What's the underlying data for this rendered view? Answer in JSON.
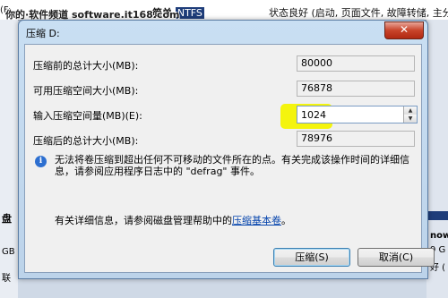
{
  "background": {
    "left_label": "(F:",
    "header_text": "简单",
    "header_fs": "NTFS",
    "status_text": "状态良好 (启动, 页面文件, 故障转储, 主分区)",
    "watermark": "你的·软件频道 software.it168.com",
    "left_disk": "盘",
    "left_b": "GB",
    "left_c": "联",
    "right_a": "now",
    "right_b": "9 G",
    "right_c": "好 ("
  },
  "dialog": {
    "title": "压缩 D:",
    "close_glyph": "✕",
    "total_before_label": "压缩前的总计大小(MB):",
    "total_before_value": "80000",
    "available_label": "可用压缩空间大小(MB):",
    "available_value": "76878",
    "enter_label": "输入压缩空间量(MB)(E):",
    "enter_value": "1024",
    "total_after_label": "压缩后的总计大小(MB):",
    "total_after_value": "78976",
    "info_icon": "info-icon",
    "info_text": "无法将卷压缩到超出任何不可移动的文件所在的点。有关完成该操作时间的详细信息，请参阅应用程序日志中的 \"defrag\" 事件。",
    "help_prefix": "有关详细信息，请参阅磁盘管理帮助中的",
    "help_link": "压缩基本卷",
    "help_suffix": "。",
    "ok_button": "压缩(S)",
    "cancel_button": "取消(C)"
  },
  "colors": {
    "highlight": "#f3f300",
    "titlebar": "#c9dff3",
    "close": "#c8432a",
    "link": "#0645ad"
  }
}
